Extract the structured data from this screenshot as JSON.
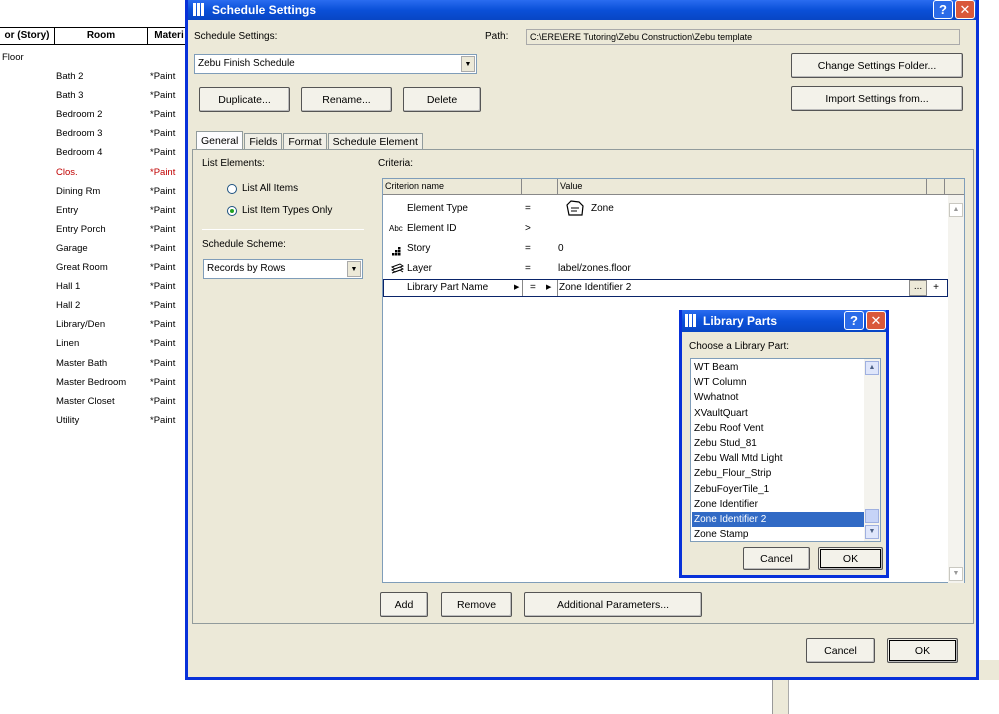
{
  "background_schedule": {
    "columns": [
      "or (Story)",
      "Room",
      "Materi"
    ],
    "group": "Floor",
    "rooms": [
      {
        "room": "Bath 2",
        "material": "*Paint",
        "red": false
      },
      {
        "room": "Bath 3",
        "material": "*Paint",
        "red": false
      },
      {
        "room": "Bedroom 2",
        "material": "*Paint",
        "red": false
      },
      {
        "room": "Bedroom 3",
        "material": "*Paint",
        "red": false
      },
      {
        "room": "Bedroom 4",
        "material": "*Paint",
        "red": false
      },
      {
        "room": "Clos.",
        "material": "*Paint",
        "red": true
      },
      {
        "room": "Dining Rm",
        "material": "*Paint",
        "red": false
      },
      {
        "room": "Entry",
        "material": "*Paint",
        "red": false
      },
      {
        "room": "Entry Porch",
        "material": "*Paint",
        "red": false
      },
      {
        "room": "Garage",
        "material": "*Paint",
        "red": false
      },
      {
        "room": "Great Room",
        "material": "*Paint",
        "red": false
      },
      {
        "room": "Hall 1",
        "material": "*Paint",
        "red": false
      },
      {
        "room": "Hall 2",
        "material": "*Paint",
        "red": false
      },
      {
        "room": "Library/Den",
        "material": "*Paint",
        "red": false
      },
      {
        "room": "Linen",
        "material": "*Paint",
        "red": false
      },
      {
        "room": "Master Bath",
        "material": "*Paint",
        "red": false
      },
      {
        "room": "Master Bedroom",
        "material": "*Paint",
        "red": false
      },
      {
        "room": "Master Closet",
        "material": "*Paint",
        "red": false
      },
      {
        "room": "Utility",
        "material": "*Paint",
        "red": false
      }
    ]
  },
  "dialog": {
    "title": "Schedule Settings",
    "help_glyph": "?",
    "close_glyph": "✕",
    "settings_label": "Schedule Settings:",
    "settings_value": "Zebu Finish Schedule",
    "path_label": "Path:",
    "path_value": "C:\\ERE\\ERE Tutoring\\Zebu Construction\\Zebu template",
    "duplicate": "Duplicate...",
    "rename": "Rename...",
    "delete": "Delete",
    "change_folder": "Change Settings Folder...",
    "import_settings": "Import Settings from...",
    "tabs": [
      "General",
      "Fields",
      "Format",
      "Schedule Element"
    ],
    "active_tab": "General",
    "list_elements_label": "List Elements:",
    "radio_all": "List All Items",
    "radio_types": "List Item Types Only",
    "scheme_label": "Schedule Scheme:",
    "scheme_value": "Records by Rows",
    "criteria_label": "Criteria:",
    "criteria_columns": [
      "Criterion name",
      "Value"
    ],
    "criteria": [
      {
        "name": "Element Type",
        "op": "=",
        "value": "Zone",
        "icon": "",
        "value_icon": "zone-icon"
      },
      {
        "name": "Element ID",
        "op": ">",
        "value": "",
        "icon": "Abc",
        "value_icon": ""
      },
      {
        "name": "Story",
        "op": "=",
        "value": "0",
        "icon": "story-icon",
        "value_icon": ""
      },
      {
        "name": "Layer",
        "op": "=",
        "value": "label/zones.floor",
        "icon": "layer-icon",
        "value_icon": ""
      },
      {
        "name": "Library Part Name",
        "op": "=",
        "value": "Zone Identifier 2",
        "icon": "",
        "value_icon": ""
      }
    ],
    "browse_glyph": "...",
    "plus_glyph": "+",
    "add": "Add",
    "remove": "Remove",
    "additional": "Additional Parameters...",
    "cancel": "Cancel",
    "ok": "OK"
  },
  "library_parts": {
    "title": "Library Parts",
    "help_glyph": "?",
    "close_glyph": "✕",
    "choose_label": "Choose a Library Part:",
    "items": [
      "WT Beam",
      "WT Column",
      "Wwhatnot",
      "XVaultQuart",
      "Zebu Roof Vent",
      "Zebu Stud_81",
      "Zebu Wall Mtd Light",
      "Zebu_Flour_Strip",
      "ZebuFoyerTile_1",
      "Zone Identifier",
      "Zone Identifier 2",
      "Zone Stamp"
    ],
    "selected": "Zone Identifier 2",
    "cancel": "Cancel",
    "ok": "OK"
  },
  "colors": {
    "title_blue": "#0a50d8",
    "selection": "#316ac5",
    "dialog_bg": "#ece9d8",
    "closet_red": "#c00000"
  }
}
